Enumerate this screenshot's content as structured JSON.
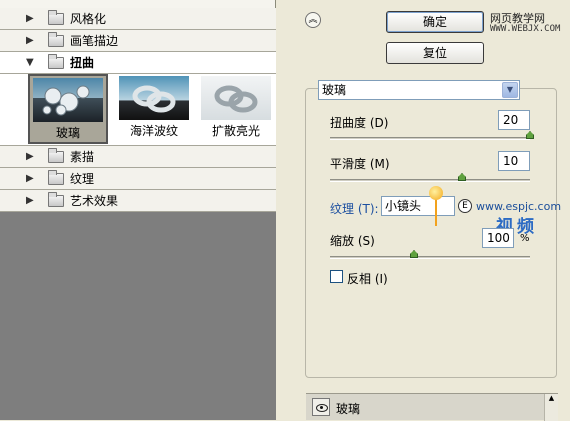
{
  "tree": {
    "groups": [
      {
        "label": "风格化",
        "state": "collapsed"
      },
      {
        "label": "画笔描边",
        "state": "collapsed"
      },
      {
        "label": "扭曲",
        "state": "expanded"
      },
      {
        "label": "素描",
        "state": "collapsed"
      },
      {
        "label": "纹理",
        "state": "collapsed"
      },
      {
        "label": "艺术效果",
        "state": "collapsed"
      }
    ],
    "thumbnails": [
      {
        "label": "玻璃",
        "selected": true
      },
      {
        "label": "海洋波纹",
        "selected": false
      },
      {
        "label": "扩散亮光",
        "selected": false
      }
    ]
  },
  "buttons": {
    "ok": "确定",
    "reset": "复位"
  },
  "watermark": {
    "site_cn": "网页教学网",
    "site_url": "WWW.WEBJX.COM",
    "url2": "www.espjc.com",
    "brand": "视频"
  },
  "settings": {
    "filter_name": "玻璃",
    "distortion": {
      "label": "扭曲度 (D)",
      "value": "20",
      "level": 1.0
    },
    "smoothness": {
      "label": "平滑度 (M)",
      "value": "10",
      "level": 0.66
    },
    "texture": {
      "label": "纹理 (T):",
      "value": "小镜头"
    },
    "scaling": {
      "label": "缩放 (S)",
      "value": "100",
      "unit": "%",
      "level": 0.42
    },
    "invert": {
      "label": "反相 (I)",
      "checked": false
    }
  },
  "layers": [
    {
      "name": "玻璃",
      "visible": true
    }
  ],
  "colors": {
    "panel_bg": "#ece9d8",
    "canvas_gray": "#7e7e7e",
    "slider_thumb": "#5fa13f"
  }
}
